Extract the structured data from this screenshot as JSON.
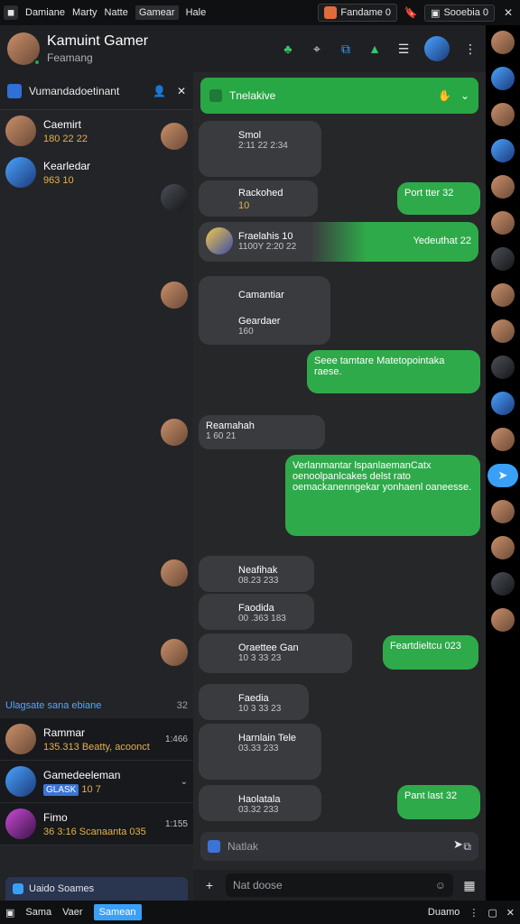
{
  "topbar": {
    "menus": [
      "Damiane",
      "Marty",
      "Natte",
      "Gamear",
      "Hale"
    ],
    "right_pill_1": "Fandame 0",
    "right_pill_2": "Sooebia 0"
  },
  "header": {
    "name": "Kamuint Gamer",
    "status": "Feamang"
  },
  "left_pane": {
    "title": "Vumandadoetinant",
    "items": [
      {
        "name": "Caemirt",
        "sub": "180 22 22"
      },
      {
        "name": "Kearledar",
        "sub": "963 10"
      }
    ],
    "section_label": "Ulagsate sana ebiane",
    "section_count": "32",
    "list2": [
      {
        "name": "Rammar",
        "meta": "1:466",
        "sub": "135.313 Beatty, acoonct"
      },
      {
        "name": "Gamedeeleman",
        "tag": "GLASK",
        "meta2": "10 7"
      },
      {
        "name": "Fimo",
        "meta": "1:155",
        "sub": "36 3:16 Scanaanta 035"
      }
    ],
    "footer": "Uaido Soames"
  },
  "chat": {
    "banner": "Tnelakive",
    "messages": [
      {
        "id": "m1",
        "dir": "in",
        "name": "Smol",
        "ts": "2:11 22 2:34"
      },
      {
        "id": "m2",
        "dir": "in",
        "name": "Rackohed",
        "ts": "10"
      },
      {
        "id": "m3",
        "dir": "out",
        "text": "Port tter 32"
      },
      {
        "id": "m4",
        "dir": "in",
        "name": "Fraelahis 10",
        "text": "Yedeuthat 22",
        "ts": "1100Y 2:20 22"
      },
      {
        "id": "m5",
        "dir": "in",
        "name": "Camantiar",
        "sub": "Geardaer",
        "ts": "160"
      },
      {
        "id": "m6",
        "dir": "out",
        "text": "Seee tamtare Matetopointaka raese."
      },
      {
        "id": "m7",
        "dir": "in",
        "name": "Reamahah",
        "ts": "1 60 21"
      },
      {
        "id": "m8",
        "dir": "out",
        "text": "Verlanmantar lspanlaemanCatx oenoolpanlcakes delst rato oemackanenngekar yonhaenl oaneesse."
      },
      {
        "id": "m9",
        "dir": "in",
        "name": "Neafihak",
        "ts": "08.23 233"
      },
      {
        "id": "m10",
        "dir": "in",
        "name": "Faodida",
        "ts": "00 .363 183"
      },
      {
        "id": "m11",
        "dir": "in",
        "name": "Oraettee Gan",
        "ts": "10 3 33 23"
      },
      {
        "id": "m12",
        "dir": "out",
        "text": "Feartdieltcu 023"
      },
      {
        "id": "m13",
        "dir": "in",
        "name": "Faedia",
        "ts": "10 3 33 23"
      },
      {
        "id": "m14",
        "dir": "in",
        "name": "Harnlain Tele",
        "ts": "03.33 233"
      },
      {
        "id": "m15",
        "dir": "in",
        "name": "Haolatala",
        "ts": "03.32 233"
      },
      {
        "id": "m16",
        "dir": "out",
        "text": "Pant last 32"
      }
    ],
    "composer_placeholder": "Natlak",
    "input_placeholder": "Nat doose"
  },
  "bottombar": {
    "tabs": [
      "Sama",
      "Vaer",
      "Samean"
    ],
    "right_1": "Duamo"
  }
}
